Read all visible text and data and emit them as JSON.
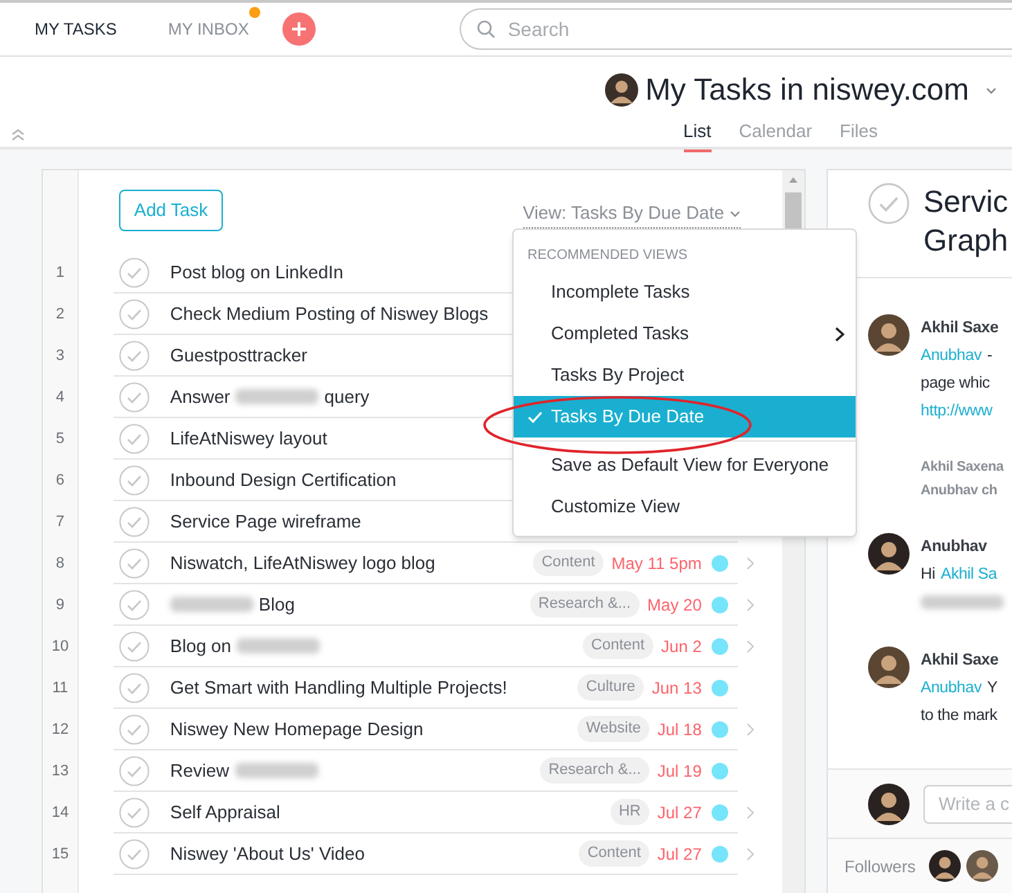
{
  "nav": {
    "items": [
      {
        "label": "MY TASKS",
        "selected": true,
        "badge": false
      },
      {
        "label": "MY INBOX",
        "selected": false,
        "badge": true
      }
    ]
  },
  "search": {
    "placeholder": "Search"
  },
  "header": {
    "title": "My Tasks in niswey.com",
    "tabs": [
      {
        "label": "List",
        "selected": true
      },
      {
        "label": "Calendar",
        "selected": false
      },
      {
        "label": "Files",
        "selected": false
      }
    ]
  },
  "list": {
    "add_button": "Add Task",
    "view_selector": "View: Tasks By Due Date",
    "tasks": [
      {
        "number": "1",
        "parts": [
          {
            "kind": "text",
            "text": "Post blog on LinkedIn"
          }
        ]
      },
      {
        "number": "2",
        "parts": [
          {
            "kind": "text",
            "text": "Check Medium Posting of Niswey Blogs"
          }
        ]
      },
      {
        "number": "3",
        "parts": [
          {
            "kind": "text",
            "text": "Guestposttracker"
          }
        ]
      },
      {
        "number": "4",
        "parts": [
          {
            "kind": "text",
            "text": "Answer"
          },
          {
            "kind": "redacted"
          },
          {
            "kind": "text",
            "text": "query"
          }
        ]
      },
      {
        "number": "5",
        "parts": [
          {
            "kind": "text",
            "text": "LifeAtNiswey layout"
          }
        ]
      },
      {
        "number": "6",
        "parts": [
          {
            "kind": "text",
            "text": "Inbound Design Certification"
          }
        ]
      },
      {
        "number": "7",
        "parts": [
          {
            "kind": "text",
            "text": "Service Page wireframe"
          }
        ]
      },
      {
        "number": "8",
        "parts": [
          {
            "kind": "text",
            "text": "Niswatch, LifeAtNiswey logo blog"
          }
        ],
        "tag": "Content",
        "due": "May 11 5pm",
        "chevron": true
      },
      {
        "number": "9",
        "parts": [
          {
            "kind": "redacted"
          },
          {
            "kind": "text",
            "text": "Blog"
          }
        ],
        "tag": "Research &...",
        "due": "May 20",
        "chevron": true
      },
      {
        "number": "10",
        "parts": [
          {
            "kind": "text",
            "text": "Blog on"
          },
          {
            "kind": "redacted"
          }
        ],
        "tag": "Content",
        "due": "Jun 2",
        "chevron": true
      },
      {
        "number": "11",
        "parts": [
          {
            "kind": "text",
            "text": "Get Smart with Handling Multiple Projects!"
          }
        ],
        "tag": "Culture",
        "due": "Jun 13",
        "chevron": false
      },
      {
        "number": "12",
        "parts": [
          {
            "kind": "text",
            "text": "Niswey New Homepage Design"
          }
        ],
        "tag": "Website",
        "due": "Jul 18",
        "chevron": true
      },
      {
        "number": "13",
        "parts": [
          {
            "kind": "text",
            "text": "Review"
          },
          {
            "kind": "redacted"
          }
        ],
        "tag": "Research &...",
        "due": "Jul 19",
        "chevron": false
      },
      {
        "number": "14",
        "parts": [
          {
            "kind": "text",
            "text": "Self Appraisal"
          }
        ],
        "tag": "HR",
        "due": "Jul 27",
        "chevron": true
      },
      {
        "number": "15",
        "parts": [
          {
            "kind": "text",
            "text": "Niswey 'About Us' Video"
          }
        ],
        "tag": "Content",
        "due": "Jul 27",
        "chevron": true
      }
    ]
  },
  "view_menu": {
    "heading": "RECOMMENDED VIEWS",
    "items": [
      {
        "label": "Incomplete Tasks",
        "selected": false,
        "submenu": false,
        "divider_before": false
      },
      {
        "label": "Completed Tasks",
        "selected": false,
        "submenu": true,
        "divider_before": false
      },
      {
        "label": "Tasks By Project",
        "selected": false,
        "submenu": false,
        "divider_before": false
      },
      {
        "label": "Tasks By Due Date",
        "selected": true,
        "submenu": false,
        "divider_before": false
      },
      {
        "label": "Save as Default View for Everyone",
        "selected": false,
        "submenu": false,
        "divider_before": true
      },
      {
        "label": "Customize View",
        "selected": false,
        "submenu": false,
        "divider_before": false
      }
    ]
  },
  "detail": {
    "title_lines": [
      "Servic",
      "Graph"
    ],
    "feed": [
      {
        "kind": "comment",
        "author": "Akhil Saxe",
        "lines": [
          [
            {
              "kind": "link",
              "text": "Anubhav"
            },
            {
              "kind": "text",
              "text": "-"
            }
          ],
          [
            {
              "kind": "text",
              "text": "page whic"
            }
          ],
          [
            {
              "kind": "link",
              "text": "http://www"
            }
          ]
        ]
      },
      {
        "kind": "activity",
        "lines": [
          "Akhil Saxena",
          "Anubhav ch"
        ]
      },
      {
        "kind": "comment",
        "author": "Anubhav",
        "lines": [
          [
            {
              "kind": "text",
              "text": "Hi"
            },
            {
              "kind": "link",
              "text": "Akhil Sa"
            }
          ],
          [
            {
              "kind": "redacted"
            }
          ]
        ]
      },
      {
        "kind": "comment",
        "author": "Akhil Saxe",
        "lines": [
          [
            {
              "kind": "link",
              "text": "Anubhav"
            },
            {
              "kind": "text",
              "text": "Y"
            }
          ],
          [
            {
              "kind": "text",
              "text": "to the mark"
            }
          ]
        ]
      }
    ],
    "composer": {
      "placeholder": "Write a c"
    },
    "followers_label": "Followers"
  }
}
